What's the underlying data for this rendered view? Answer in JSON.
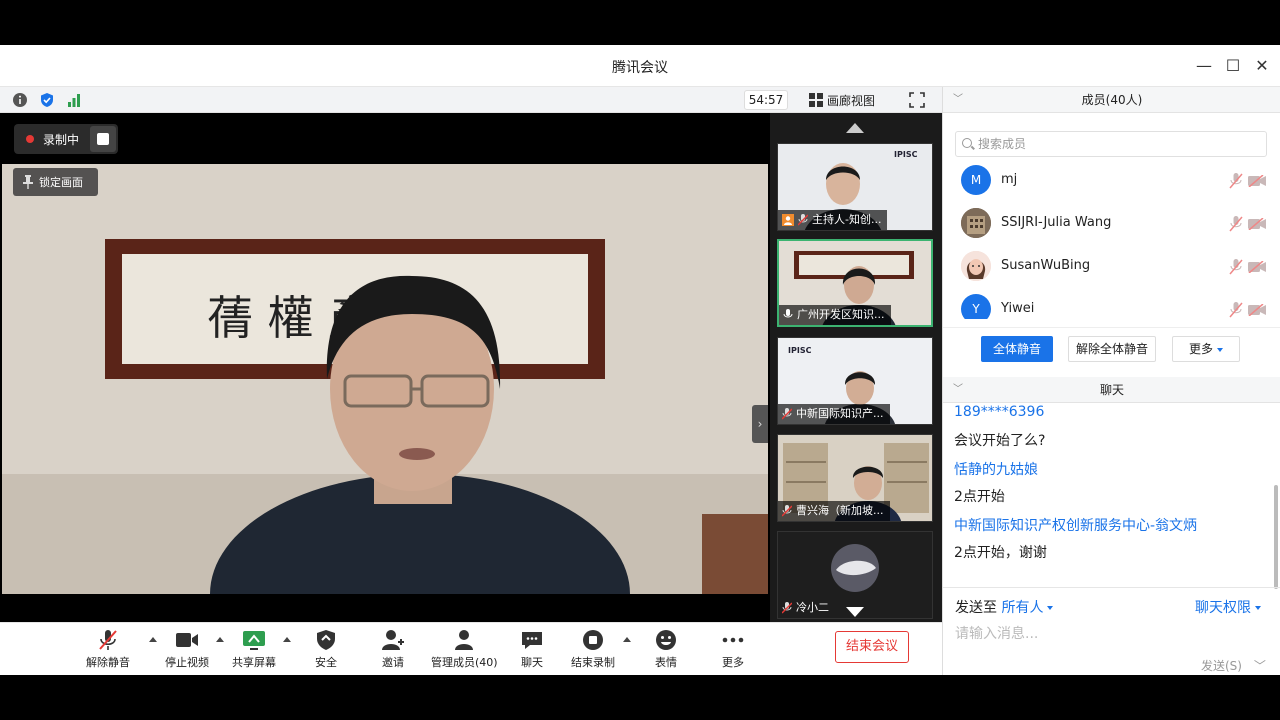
{
  "window": {
    "title": "腾讯会议",
    "minimize": "—",
    "maximize": "☐",
    "close": "✕"
  },
  "info_bar": {
    "timer": "54:57",
    "gallery_label": "画廊视图"
  },
  "recording": {
    "status": "录制中"
  },
  "lock_label": "锁定画面",
  "thumbnails": [
    {
      "label": "主持人-知创..."
    },
    {
      "label": "广州开发区知识..."
    },
    {
      "label": "中新国际知识产..."
    },
    {
      "label": "曹兴海（新加坡..."
    },
    {
      "label": "冷小二"
    }
  ],
  "thumbnail_logo": "IPISC",
  "toolbar": {
    "unmute": "解除静音",
    "stop_video": "停止视频",
    "share_screen": "共享屏幕",
    "security": "安全",
    "invite": "邀请",
    "manage_members": "管理成员(40)",
    "chat": "聊天",
    "end_recording": "结束录制",
    "emoji": "表情",
    "more": "更多",
    "end_meeting": "结束会议"
  },
  "members_panel": {
    "title": "成员(40人)",
    "search_placeholder": "搜索成员",
    "members": [
      {
        "initial": "M",
        "name": "mj",
        "avatar_color": "#1a73e8"
      },
      {
        "initial": "",
        "name": "SSIJRI-Julia Wang",
        "avatar_color": "#6b5a4a"
      },
      {
        "initial": "",
        "name": "SusanWuBing",
        "avatar_color": "#f3d9d2"
      },
      {
        "initial": "Y",
        "name": "Yiwei",
        "avatar_color": "#1a73e8"
      }
    ],
    "mute_all": "全体静音",
    "unmute_all": "解除全体静音",
    "more": "更多"
  },
  "chat_panel": {
    "title": "聊天",
    "messages": [
      {
        "sender": "189****6396",
        "text": "会议开始了么?"
      },
      {
        "sender": "恬静的九姑娘",
        "text": "2点开始"
      },
      {
        "sender": "中新国际知识产权创新服务中心-翁文炳",
        "text": "2点开始，谢谢"
      }
    ],
    "send_to_label": "发送至",
    "send_to_target": "所有人",
    "permission": "聊天权限",
    "input_placeholder": "请输入消息...",
    "send_button": "发送(S)"
  },
  "colors": {
    "accent": "#1a73e8",
    "danger": "#e53935",
    "active_border": "#3cb371"
  }
}
